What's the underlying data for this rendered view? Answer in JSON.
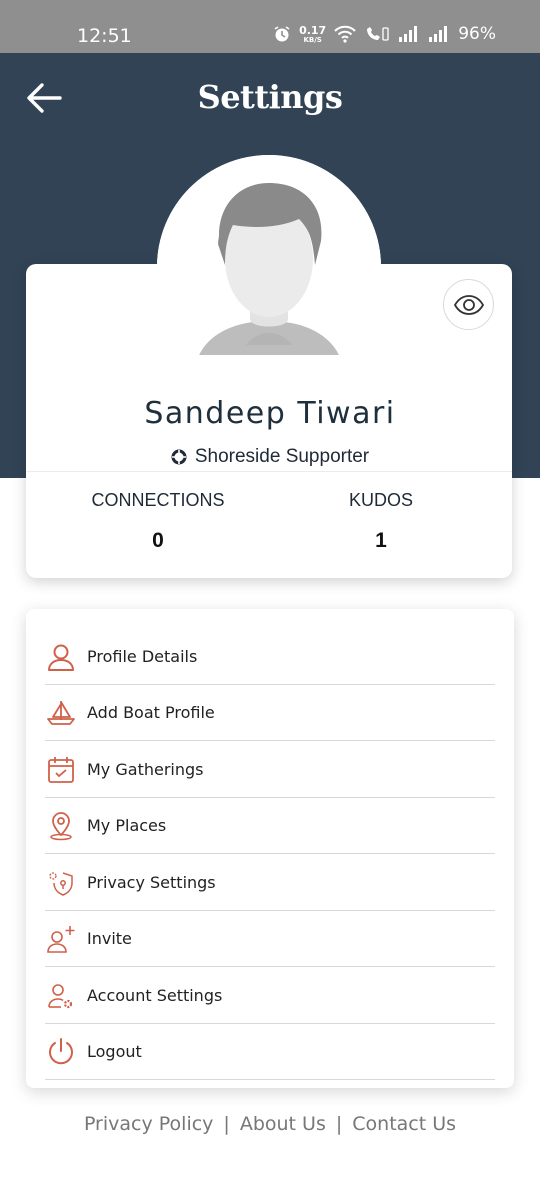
{
  "status_bar": {
    "time": "12:51",
    "net_speed_value": "0.17",
    "net_speed_unit": "KB/S",
    "battery": "96%"
  },
  "header": {
    "title": "Settings",
    "background_color": "#314355"
  },
  "profile": {
    "name": "Sandeep Tiwari",
    "role": "Shoreside Supporter",
    "connections_label": "CONNECTIONS",
    "connections_value": "0",
    "kudos_label": "KUDOS",
    "kudos_value": "1"
  },
  "menu": {
    "accent_color": "#d0604a",
    "items": [
      {
        "label": "Profile Details",
        "icon": "user-icon"
      },
      {
        "label": "Add Boat Profile",
        "icon": "boat-icon"
      },
      {
        "label": "My Gatherings",
        "icon": "calendar-check-icon"
      },
      {
        "label": "My Places",
        "icon": "location-pin-icon"
      },
      {
        "label": "Privacy Settings",
        "icon": "privacy-shield-icon"
      },
      {
        "label": "Invite",
        "icon": "add-user-icon"
      },
      {
        "label": "Account Settings",
        "icon": "user-gear-icon"
      },
      {
        "label": "Logout",
        "icon": "power-icon"
      }
    ]
  },
  "footer": {
    "privacy": "Privacy Policy",
    "about": "About Us",
    "contact": "Contact Us",
    "separator": "|"
  }
}
